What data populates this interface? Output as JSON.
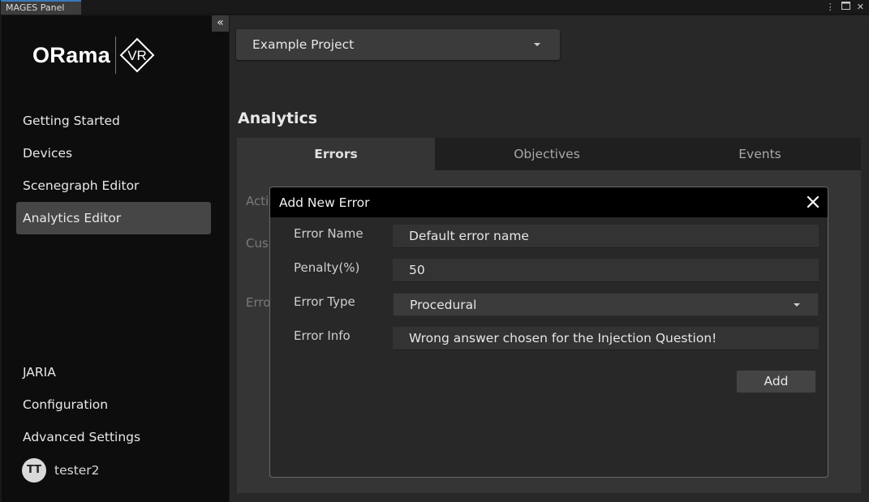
{
  "window": {
    "tab_title": "MAGES Panel",
    "controls": {
      "menu_icon": "kebab-menu-icon",
      "maximize_icon": "maximize-icon",
      "close_icon": "close-icon"
    }
  },
  "sidebar": {
    "collapse_icon": "double-chevron-left-icon",
    "logo": {
      "text": "ORama",
      "badge": "VR"
    },
    "top_items": [
      {
        "label": "Getting Started"
      },
      {
        "label": "Devices"
      },
      {
        "label": "Scenegraph Editor"
      },
      {
        "label": "Analytics Editor",
        "active": true
      }
    ],
    "bottom_items": [
      {
        "label": "JARIA"
      },
      {
        "label": "Configuration"
      },
      {
        "label": "Advanced Settings"
      }
    ],
    "user": {
      "initials": "TT",
      "name": "tester2"
    }
  },
  "main": {
    "project_select": {
      "value": "Example Project"
    },
    "section_title": "Analytics",
    "tabs": [
      {
        "label": "Errors",
        "active": true
      },
      {
        "label": "Objectives"
      },
      {
        "label": "Events"
      }
    ],
    "background_labels": [
      "Acti",
      "Cus",
      "Erro"
    ]
  },
  "modal": {
    "title": "Add New Error",
    "fields": [
      {
        "label": "Error Name",
        "value": "Default error name"
      },
      {
        "label": "Penalty(%)",
        "value": "50"
      },
      {
        "label": "Error Type",
        "value": "Procedural"
      },
      {
        "label": "Error Info",
        "value": "Wrong answer chosen for the Injection Question!"
      }
    ],
    "add_label": "Add"
  },
  "colors": {
    "sidebar_bg": "#0d0d0d",
    "main_bg": "#282828",
    "active_item_bg": "#464646",
    "modal_header_bg": "#000000",
    "tab_accent": "#3a79bb"
  }
}
